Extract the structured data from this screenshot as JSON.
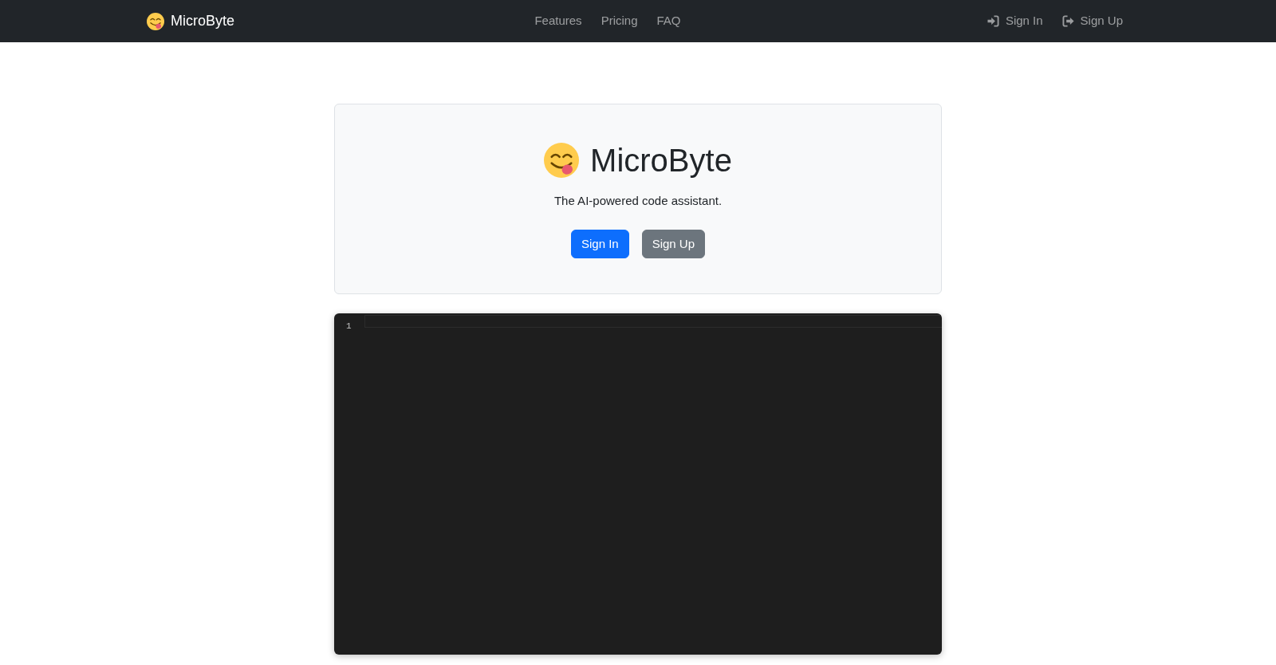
{
  "navbar": {
    "brand": "MicroByte",
    "links": [
      {
        "label": "Features"
      },
      {
        "label": "Pricing"
      },
      {
        "label": "FAQ"
      }
    ],
    "actions": [
      {
        "label": "Sign In",
        "kind": "sign-in"
      },
      {
        "label": "Sign Up",
        "kind": "sign-up"
      }
    ]
  },
  "hero": {
    "title": "MicroByte",
    "tagline": "The AI-powered code assistant.",
    "buttons": [
      {
        "label": "Sign In",
        "kind": "primary"
      },
      {
        "label": "Sign Up",
        "kind": "secondary"
      }
    ]
  },
  "editor": {
    "line_numbers": [
      "1"
    ]
  }
}
